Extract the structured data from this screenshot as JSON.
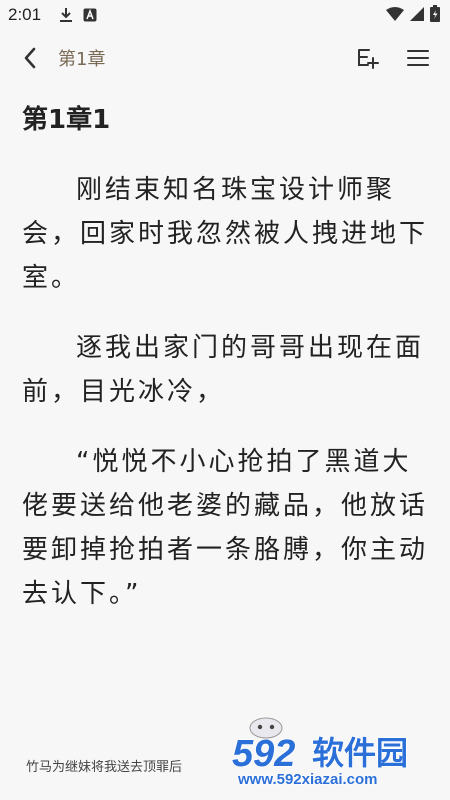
{
  "status_bar": {
    "time": "2:01"
  },
  "top_bar": {
    "chapter_short": "第1章"
  },
  "content": {
    "chapter_title": "第1章1",
    "paragraphs": [
      "刚结束知名珠宝设计师聚会，回家时我忽然被人拽进地下室。",
      "逐我出家门的哥哥出现在面前，目光冰冷，",
      "“悦悦不小心抢拍了黑道大佬要送给他老婆的藏品，他放话要卸掉抢拍者一条胳膊，你主动去认下。”"
    ]
  },
  "footer": {
    "book_title": "竹马为继妹将我送去顶罪后"
  },
  "watermark": {
    "logo_number": "592",
    "logo_text": "软件园",
    "url": "www.592xiazai.com"
  },
  "colors": {
    "background": "#f7f7f7",
    "chapter_short": "#7a6a55",
    "watermark_blue": "#2b6fd8"
  }
}
